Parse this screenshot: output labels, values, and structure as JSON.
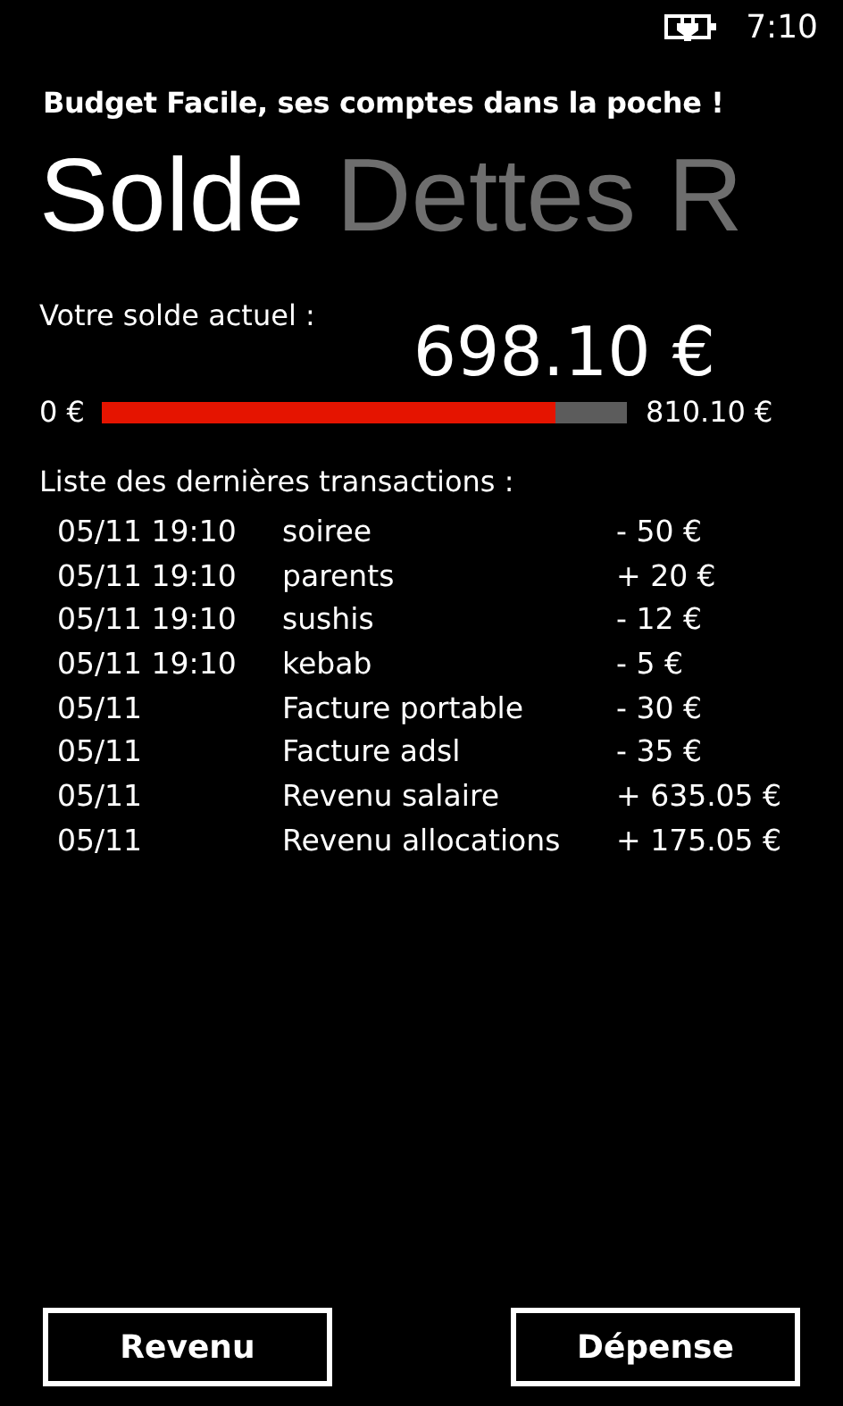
{
  "status_bar": {
    "time": "7:10"
  },
  "app_title": "Budget Facile, ses comptes dans la poche !",
  "pivot": [
    {
      "label": "Solde",
      "selected": true
    },
    {
      "label": "Dettes",
      "selected": false
    },
    {
      "label": "R",
      "selected": false
    }
  ],
  "balance": {
    "label": "Votre solde actuel :",
    "amount": "698.10 €",
    "min": "0 €",
    "max": "810.10 €",
    "level": 0.862
  },
  "transactions_title": "Liste des dernières transactions :",
  "transactions": [
    {
      "date": "05/11 19:10",
      "label": "soiree",
      "amount": "- 50 €"
    },
    {
      "date": "05/11 19:10",
      "label": "parents",
      "amount": "+ 20 €"
    },
    {
      "date": "05/11 19:10",
      "label": "sushis",
      "amount": "- 12 €"
    },
    {
      "date": "05/11 19:10",
      "label": "kebab",
      "amount": "- 5 €"
    },
    {
      "date": "05/11",
      "label": "Facture portable",
      "amount": "- 30 €"
    },
    {
      "date": "05/11",
      "label": "Facture adsl",
      "amount": "- 35 €"
    },
    {
      "date": "05/11",
      "label": "Revenu salaire",
      "amount": "+ 635.05 €"
    },
    {
      "date": "05/11",
      "label": "Revenu allocations",
      "amount": "+ 175.05 €"
    }
  ],
  "buttons": [
    "Revenu",
    "Dépense"
  ]
}
